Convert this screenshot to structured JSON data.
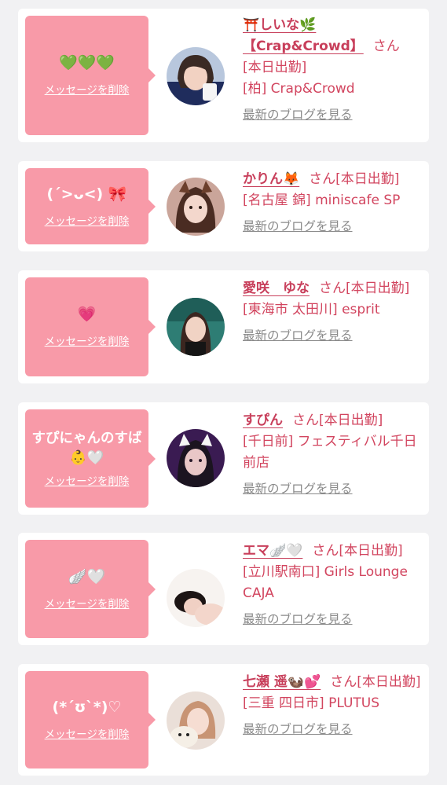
{
  "delete_label": "メッセージを削除",
  "blog_label": "最新のブログを見る",
  "honorific": "さん",
  "colors": {
    "page_background": "#f1f1f3",
    "card_background": "#ffffff",
    "bubble": "#f89aa8",
    "accent_text": "#d2455f",
    "link_gray": "#8a8a8a"
  },
  "entries": [
    {
      "message": "💚💚💚",
      "name": "⛩️しいな🌿【Crap&Crowd】",
      "status": "[本日出勤]",
      "store": "[柏] Crap&Crowd"
    },
    {
      "message": "(ˊ>ᴗ<) 🎀",
      "name": "かりん🦊",
      "status": "[本日出勤]",
      "store": "[名古屋 錦] miniscafe SP"
    },
    {
      "message": "💗",
      "name": "愛咲　ゆな",
      "status": "[本日出勤]",
      "store": "[東海市 太田川] esprit"
    },
    {
      "message": "すぴにゃんのすば👶🤍",
      "name": "すぴん",
      "status": "[本日出勤]",
      "store": "[千日前] フェスティバル千日前店"
    },
    {
      "message": "🪽🤍",
      "name": "エマ🪽🤍",
      "status": "[本日出勤]",
      "store": "[立川駅南口] Girls Lounge CAJA"
    },
    {
      "message": "(*´ʊ`*)♡",
      "name": "七瀬 遥🦦💕",
      "status": "[本日出勤]",
      "store": "[三重 四日市] PLUTUS"
    }
  ]
}
